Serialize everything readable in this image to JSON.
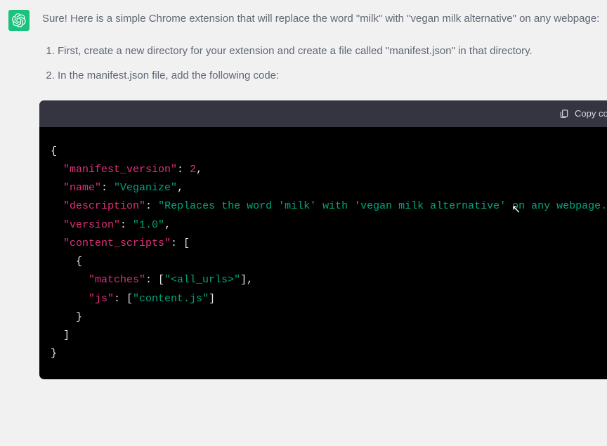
{
  "message": {
    "intro": "Sure! Here is a simple Chrome extension that will replace the word \"milk\" with \"vegan milk alternative\" on any webpage:",
    "steps": [
      "First, create a new directory for your extension and create a file called \"manifest.json\" in that directory.",
      "In the manifest.json file, add the following code:"
    ]
  },
  "codeblock": {
    "copy_label": "Copy code",
    "json": {
      "k_manifest_version": "\"manifest_version\"",
      "v_manifest_version": "2",
      "k_name": "\"name\"",
      "v_name": "\"Veganize\"",
      "k_description": "\"description\"",
      "v_description": "\"Replaces the word 'milk' with 'vegan milk alternative' on any webpage.\"",
      "k_version": "\"version\"",
      "v_version": "\"1.0\"",
      "k_content_scripts": "\"content_scripts\"",
      "k_matches": "\"matches\"",
      "v_matches": "\"<all_urls>\"",
      "k_js": "\"js\"",
      "v_js": "\"content.js\""
    }
  }
}
